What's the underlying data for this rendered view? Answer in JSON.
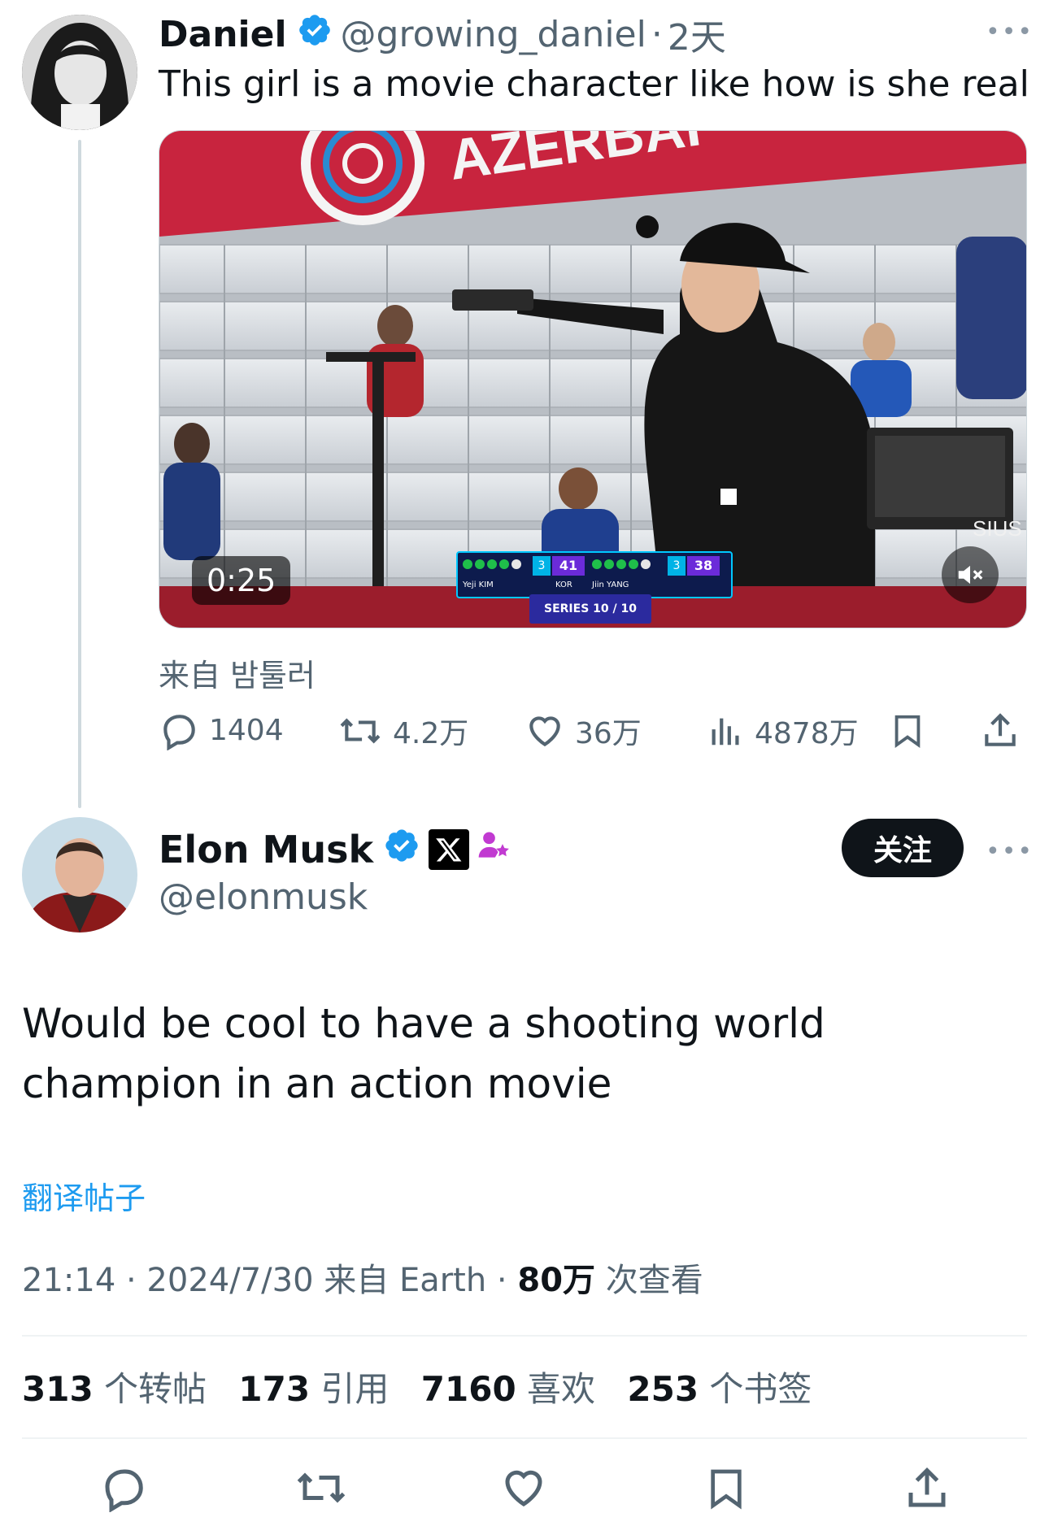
{
  "parent_tweet": {
    "author_name": "Daniel",
    "handle": "@growing_daniel",
    "time_ago": "2天",
    "separator": "·",
    "text": "This girl is a movie character like how is she real",
    "video": {
      "duration": "0:25",
      "banner_text": "AZERBAI",
      "scoreboard": {
        "player1_name": "Yeji KIM",
        "player1_series": "3",
        "player1_total": "41",
        "player2_name": "Jiin YANG",
        "player2_series": "3",
        "player2_total": "38",
        "country": "KOR",
        "series_label": "SERIES 10 / 10"
      },
      "monitor_brand": "SIUS"
    },
    "source": "来自 밤툴러",
    "replies": "1404",
    "reposts": "4.2万",
    "likes": "36万",
    "views": "4878万"
  },
  "main_tweet": {
    "author_name": "Elon Musk",
    "handle": "@elonmusk",
    "follow_label": "关注",
    "text": "Would be cool to have a shooting world champion in an action movie",
    "translate_label": "翻译帖子",
    "meta_prefix": "21:14 · 2024/7/30 来自 Earth · ",
    "views_count": "80万",
    "views_suffix": " 次查看",
    "stats": [
      {
        "n": "313",
        "label": " 个转帖"
      },
      {
        "n": "173",
        "label": " 引用"
      },
      {
        "n": "7160",
        "label": " 喜欢"
      },
      {
        "n": "253",
        "label": " 个书签"
      }
    ]
  },
  "colors": {
    "verified_blue": "#1d9bf0",
    "secondary_text": "#536471",
    "follow_button": "#0f1419",
    "link_blue": "#1d9bf0"
  },
  "icons": {
    "reply": "speech-bubble-icon",
    "repost": "repost-arrows-icon",
    "like": "heart-icon",
    "views": "bar-chart-icon",
    "bookmark": "bookmark-icon",
    "share": "share-upload-icon",
    "verified": "verified-badge-icon",
    "affiliate": "x-logo-badge-icon",
    "more": "more-dots-icon",
    "mute": "muted-speaker-icon"
  }
}
